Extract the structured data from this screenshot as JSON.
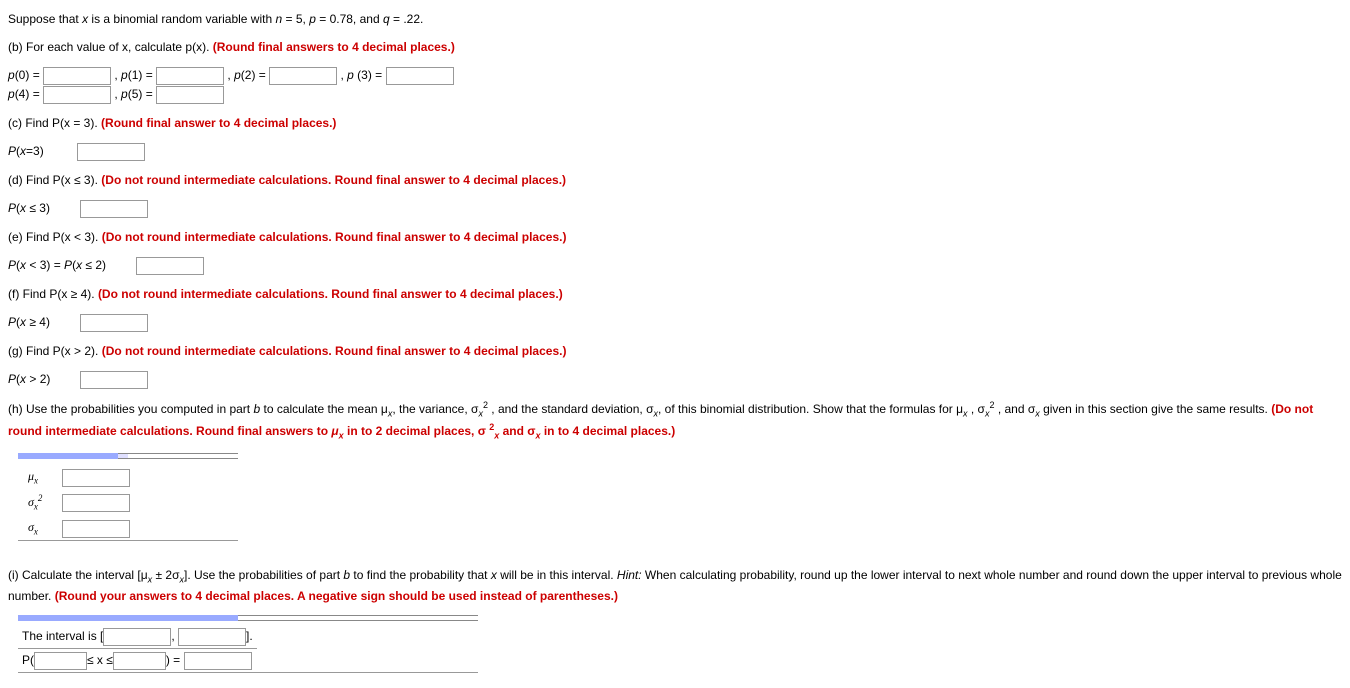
{
  "intro": "Suppose that x is a binomial random variable with n = 5, p = 0.78, and q = .22.",
  "partB": {
    "prompt": "(b) For each value of x, calculate p(x). ",
    "hint": "(Round final answers to 4 decimal places.)",
    "p0": "p(0) = ",
    "p1": ", p(1) = ",
    "p2": ", p(2) = ",
    "p3": ", p (3) = ",
    "p4": "p(4) = ",
    "p5": ", p(5) = "
  },
  "partC": {
    "prompt": "(c) Find P(x = 3). ",
    "hint": "(Round final answer to 4 decimal places.)",
    "label": "P(x=3)"
  },
  "partD": {
    "prompt": "(d) Find P(x ≤ 3). ",
    "hint": "(Do not round intermediate calculations. Round final answer to 4 decimal places.)",
    "label": "P(x ≤ 3)"
  },
  "partE": {
    "prompt": "(e) Find P(x < 3). ",
    "hint": "(Do not round intermediate calculations. Round final answer to 4 decimal places.)",
    "label": "P(x < 3) = P(x ≤ 2)"
  },
  "partF": {
    "prompt": "(f) Find P(x ≥ 4). ",
    "hint": "(Do not round intermediate calculations. Round final answer to 4 decimal places.)",
    "label": "P(x ≥ 4)"
  },
  "partG": {
    "prompt": "(g) Find P(x > 2). ",
    "hint": "(Do not round intermediate calculations. Round final answer to 4 decimal places.)",
    "label": "P(x > 2)"
  },
  "partH": {
    "prompt1": "(h) Use the probabilities you computed in part ",
    "promptItalicB": "b",
    "prompt2": " to calculate the mean μ",
    "prompt3": ", the variance, σ",
    "prompt4": " , and the standard deviation, σ",
    "prompt5": " of this binomial distribution. Show that the formulas for μ",
    "prompt6": " , σ",
    "prompt7": " , and σ",
    "prompt8": " given in this section give the same results. ",
    "hint1": "(Do not round intermediate calculations. Round final answers to ",
    "hintMu": "μ",
    "hintMuSub": "x",
    "hint2": " in to 2 decimal places, σ ",
    "hint2sup": "2",
    "hint2sub": "x",
    "hint3": " and σ",
    "hint3sub": "x",
    "hint4": " in to 4 decimal places.)",
    "row1": "μ",
    "row1sub": "x",
    "row2": "σ",
    "row2sub": "x",
    "row2sup": "2",
    "row3": "σ",
    "row3sub": "x"
  },
  "partI": {
    "prompt1": "(i) Calculate the interval [μ",
    "prompt2": " ± 2σ",
    "prompt3": "]. Use the probabilities of part ",
    "promptItalicB": "b",
    "prompt4": " to find the probability that ",
    "promptItalicX": "x",
    "prompt5": " will be in this interval. ",
    "hintPrefix": "Hint: ",
    "hintText": "When calculating probability, round up the lower interval to next whole number and round down the upper interval to previous whole number. ",
    "redHint": "(Round your answers to 4 decimal places. A negative sign should be used instead of parentheses.)",
    "intervalLabel": "The interval is [",
    "intervalComma": ", ",
    "intervalClose": "].",
    "pLabel": "P(",
    "leq1": "≤ x ≤",
    "equals": ") = "
  }
}
